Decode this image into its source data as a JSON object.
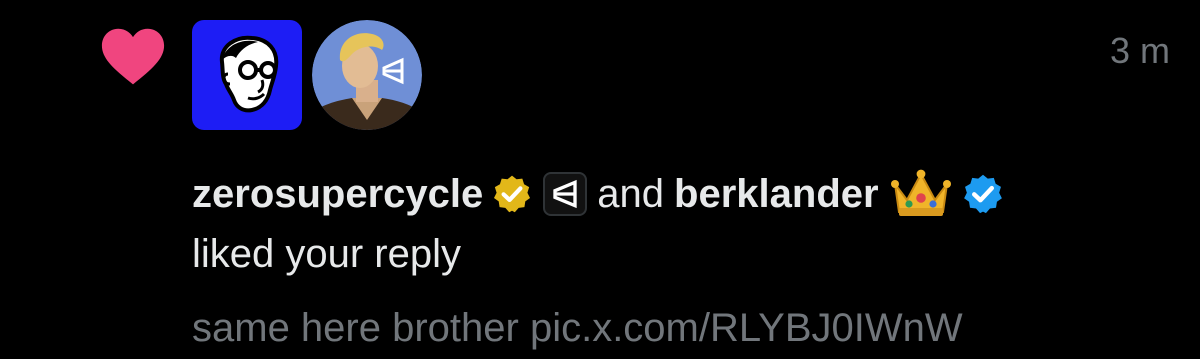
{
  "notification": {
    "timestamp": "3 m",
    "actor_1": "zerosupercycle",
    "conjunction": "and",
    "actor_2": "berklander",
    "action": "liked your reply",
    "preview": "same here brother pic.x.com/RLYBJ0IWnW"
  },
  "icons": {
    "like": "heart-icon",
    "verified_gold": "gold-verified-badge-icon",
    "affiliate": "affiliate-logo-icon",
    "crown": "crown-icon",
    "verified_blue": "blue-verified-badge-icon"
  },
  "colors": {
    "background": "#000000",
    "heart": "#f0457f",
    "text_primary": "#e7e9ea",
    "text_secondary": "#71767b",
    "avatar_1_bg": "#1d1df5",
    "verified_gold": "#e2b719",
    "verified_blue": "#1d9bf0"
  }
}
